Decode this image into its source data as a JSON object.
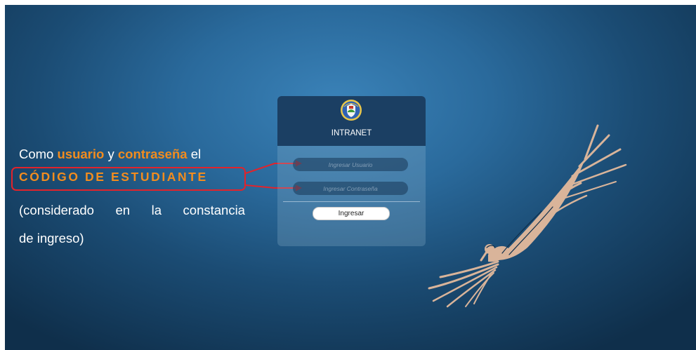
{
  "instruction": {
    "line1_prefix": "Como",
    "line1_user": "usuario",
    "line1_and": "y",
    "line1_pass": "contraseña",
    "line1_suffix": "el",
    "code": "CÓDIGO DE ESTUDIANTE",
    "line3_words": [
      "(considerado",
      "en",
      "la",
      "constancia"
    ],
    "line4": "de ingreso)"
  },
  "login": {
    "title": "INTRANET",
    "username_placeholder": "Ingresar Usuario",
    "password_placeholder": "Ingresar Contraseña",
    "submit_label": "Ingresar"
  },
  "colors": {
    "highlight": "#f28c1e",
    "annotation_red": "#e2232b",
    "panel_header": "#1b3f63"
  },
  "icons": {
    "crest": "university-crest-icon",
    "condor": "condor-illustration"
  }
}
